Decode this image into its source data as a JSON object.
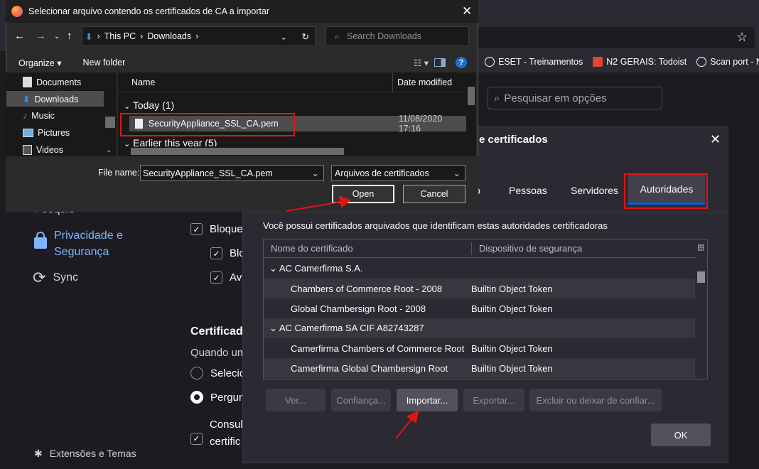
{
  "browser": {
    "bookmarks": [
      "ESET - Treinamentos",
      "N2 GERAIS: Todoist",
      "Scan port - NMAP"
    ]
  },
  "settings": {
    "search_placeholder": "Pesquisar em opções",
    "nav": {
      "search_partial": "Pesquis",
      "privacy": "Privacidade e Segurança",
      "privacy_line1": "Privacidade e",
      "privacy_line2": "Segurança",
      "sync": "Sync",
      "extensions": "Extensões e Temas"
    },
    "rows": {
      "block_a": "Bloque",
      "block_b": "Blo",
      "block_c": "Av",
      "cert_heading": "Certificad",
      "when_label": "Quando um",
      "select_auto": "Selecio",
      "ask": "Pergun",
      "consult": "Consult",
      "consult_2": "certific"
    }
  },
  "cert_manager": {
    "title": "e certificados",
    "tabs": [
      "o",
      "Pessoas",
      "Servidores",
      "Autoridades"
    ],
    "active_tab": "Autoridades",
    "description": "Você possui certificados arquivados que identificam estas autoridades certificadoras",
    "columns": [
      "Nome do certificado",
      "Dispositivo de segurança"
    ],
    "rows": [
      {
        "type": "group",
        "name": "AC Camerfirma S.A."
      },
      {
        "type": "item",
        "name": "Chambers of Commerce Root - 2008",
        "device": "Builtin Object Token"
      },
      {
        "type": "item",
        "name": "Global Chambersign Root - 2008",
        "device": "Builtin Object Token"
      },
      {
        "type": "group",
        "name": "AC Camerfirma SA CIF A82743287"
      },
      {
        "type": "item",
        "name": "Camerfirma Chambers of Commerce Root",
        "device": "Builtin Object Token"
      },
      {
        "type": "item",
        "name": "Camerfirma Global Chambersign Root",
        "device": "Builtin Object Token"
      }
    ],
    "buttons": {
      "view": "Ver...",
      "trust": "Confiança...",
      "import": "Importar...",
      "export": "Exportar...",
      "delete": "Excluir ou deixar de confiar...",
      "ok": "OK"
    }
  },
  "file_dialog": {
    "title": "Selecionar arquivo contendo os certificados de CA a importar",
    "breadcrumb": [
      "This PC",
      "Downloads"
    ],
    "search_placeholder": "Search Downloads",
    "toolbar": {
      "organize": "Organize",
      "new_folder": "New folder"
    },
    "sidebar": [
      "Documents",
      "Downloads",
      "Music",
      "Pictures",
      "Videos"
    ],
    "columns": {
      "name": "Name",
      "date": "Date modified"
    },
    "groups": [
      "Today (1)",
      "Earlier this year (5)"
    ],
    "file": {
      "name": "SecurityAppliance_SSL_CA.pem",
      "date": "11/08/2020 17:16"
    },
    "file_name_label": "File name:",
    "file_name_value": "SecurityAppliance_SSL_CA.pem",
    "file_type": "Arquivos de certificados",
    "open": "Open",
    "cancel": "Cancel"
  },
  "colors": {
    "highlight_red": "#e01515",
    "accent_blue": "#0060df"
  }
}
